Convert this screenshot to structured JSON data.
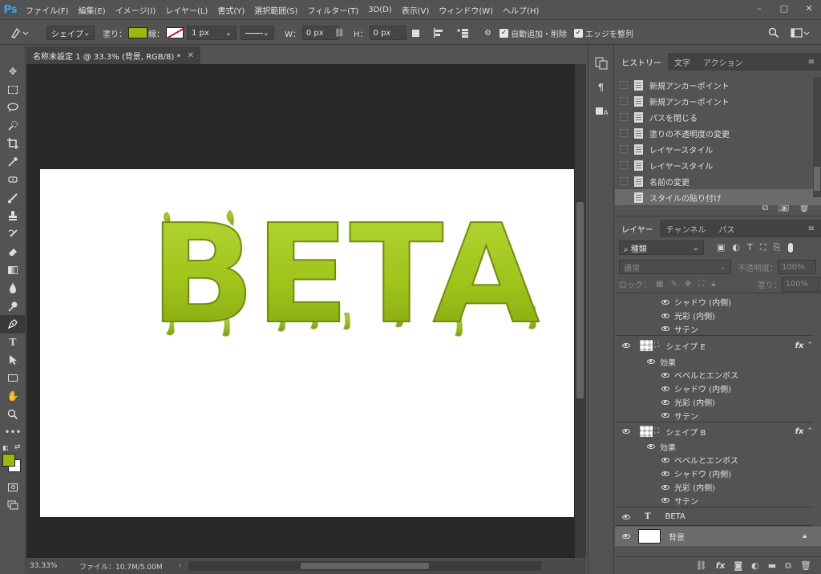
{
  "app": {
    "logo": "Ps"
  },
  "menu": [
    "ファイル(F)",
    "編集(E)",
    "イメージ(I)",
    "レイヤー(L)",
    "書式(Y)",
    "選択範囲(S)",
    "フィルター(T)",
    "3D(D)",
    "表示(V)",
    "ウィンドウ(W)",
    "ヘルプ(H)"
  ],
  "window_controls": {
    "minimize": "–",
    "maximize": "□",
    "close": "✕"
  },
  "options": {
    "tool_mode": "シェイプ",
    "fill_label": "塗り：",
    "stroke_label": "線：",
    "stroke_width": "1 px",
    "w_label": "W：",
    "w_value": "0 px",
    "h_label": "H：",
    "h_value": "0 px",
    "auto_add_delete": "自動追加・削除",
    "align_edges": "エッジを整列",
    "fill_color": "#9ab80e"
  },
  "document": {
    "tab_title": "名称未設定 1 @ 33.3% (背景, RGB/8) *",
    "canvas_text": "BETA",
    "slime_color": "#9fc41a",
    "zoom": "33.33%",
    "file_info": "ファイル：10.7M/5.00M"
  },
  "history": {
    "tabs": [
      "ヒストリー",
      "文字",
      "アクション"
    ],
    "items": [
      "新規アンカーポイント",
      "新規アンカーポイント",
      "パスを閉じる",
      "塗りの不透明度の変更",
      "レイヤースタイル",
      "レイヤースタイル",
      "名前の変更",
      "スタイルの貼り付け"
    ]
  },
  "layers": {
    "tabs": [
      "レイヤー",
      "チャンネル",
      "パス"
    ],
    "filter_kind": "種類",
    "blend_mode": "通常",
    "opacity_label": "不透明度：",
    "opacity_value": "100%",
    "lock_label": "ロック：",
    "fill_label": "塗り：",
    "fill_value": "100%",
    "top_effects": [
      "シャドウ (内側)",
      "光彩 (内側)",
      "サテン"
    ],
    "shape_e": {
      "name": "シェイプ E",
      "effects_label": "効果",
      "effects": [
        "ベベルとエンボス",
        "シャドウ (内側)",
        "光彩 (内側)",
        "サテン"
      ]
    },
    "shape_b": {
      "name": "シェイプ B",
      "effects_label": "効果",
      "effects": [
        "ベベルとエンボス",
        "シャドウ (内側)",
        "光彩 (内側)",
        "サテン"
      ]
    },
    "text_layer": {
      "type_glyph": "T",
      "name": "BETA"
    },
    "background": {
      "name": "背景"
    }
  }
}
